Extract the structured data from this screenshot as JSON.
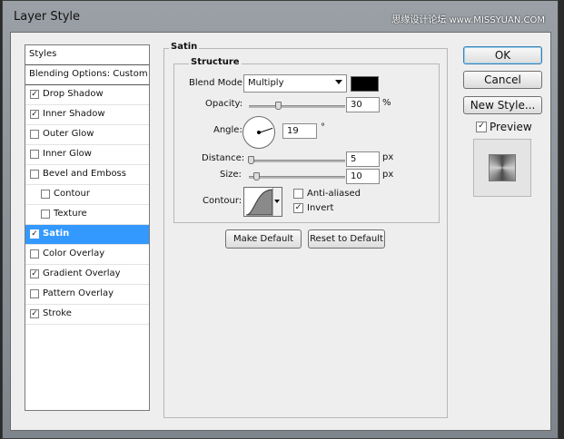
{
  "window": {
    "title": "Layer Style",
    "watermark": "思缘设计论坛 www.MISSYUAN.COM"
  },
  "styles_list": {
    "items": [
      {
        "label": "Styles",
        "checked": null,
        "selected": false
      },
      {
        "label": "Blending Options: Custom",
        "checked": null,
        "selected": false
      },
      {
        "label": "Drop Shadow",
        "checked": true,
        "selected": false
      },
      {
        "label": "Inner Shadow",
        "checked": true,
        "selected": false
      },
      {
        "label": "Outer Glow",
        "checked": false,
        "selected": false
      },
      {
        "label": "Inner Glow",
        "checked": false,
        "selected": false
      },
      {
        "label": "Bevel and Emboss",
        "checked": false,
        "selected": false
      },
      {
        "label": "Contour",
        "checked": false,
        "selected": false
      },
      {
        "label": "Texture",
        "checked": false,
        "selected": false
      },
      {
        "label": "Satin",
        "checked": true,
        "selected": true
      },
      {
        "label": "Color Overlay",
        "checked": false,
        "selected": false
      },
      {
        "label": "Gradient Overlay",
        "checked": true,
        "selected": false
      },
      {
        "label": "Pattern Overlay",
        "checked": false,
        "selected": false
      },
      {
        "label": "Stroke",
        "checked": true,
        "selected": false
      }
    ]
  },
  "satin": {
    "group_title": "Satin",
    "structure_title": "Structure",
    "blend_mode_label": "Blend Mode:",
    "blend_mode_value": "Multiply",
    "blend_color": "#000000",
    "opacity_label": "Opacity:",
    "opacity_value": "30",
    "opacity_unit": "%",
    "opacity_fraction": 0.3,
    "angle_label": "Angle:",
    "angle_value": "19",
    "angle_unit": "°",
    "distance_label": "Distance:",
    "distance_value": "5",
    "distance_unit": "px",
    "size_label": "Size:",
    "size_value": "10",
    "size_unit": "px",
    "contour_label": "Contour:",
    "anti_aliased_label": "Anti-aliased",
    "anti_aliased_checked": false,
    "invert_label": "Invert",
    "invert_checked": true,
    "make_default_label": "Make Default",
    "reset_default_label": "Reset to Default"
  },
  "actions": {
    "ok_label": "OK",
    "cancel_label": "Cancel",
    "new_style_label": "New Style...",
    "preview_label": "Preview",
    "preview_checked": true
  },
  "check_glyph": "✓"
}
